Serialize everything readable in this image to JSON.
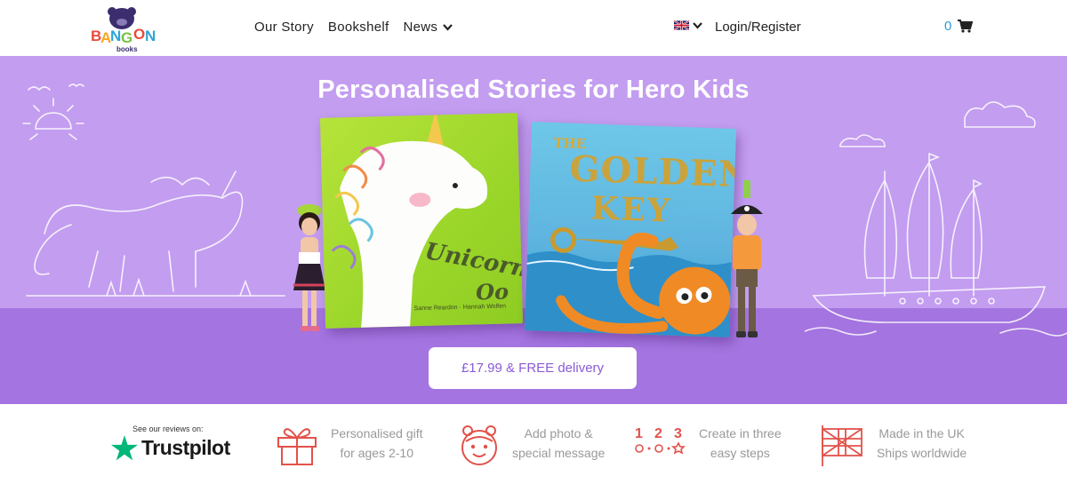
{
  "header": {
    "logo_text": "BANG ON books",
    "nav": [
      "Our Story",
      "Bookshelf",
      "News"
    ],
    "login": "Login/Register",
    "cart_count": "0",
    "flag_icon": "uk-flag-icon"
  },
  "hero": {
    "title": "Personalised Stories for Hero Kids",
    "book1": {
      "title_line1": "Unicorn",
      "title_line2": "Oo",
      "authors": "Sanne Reardon · Hannah Wolfen"
    },
    "book2": {
      "title_line1": "THE",
      "title_line2": "GOLDEN",
      "title_line3": "KEY"
    },
    "price_button": "£17.99 & FREE delivery"
  },
  "features": {
    "trustpilot_caption": "See our reviews on:",
    "trustpilot_name": "Trustpilot",
    "items": [
      {
        "line1": "Personalised gift",
        "line2": "for ages 2-10",
        "icon": "gift-icon"
      },
      {
        "line1": "Add photo &",
        "line2": "special message",
        "icon": "child-face-icon"
      },
      {
        "line1": "Create in three",
        "line2": "easy steps",
        "icon": "steps-123-icon"
      },
      {
        "line1": "Made in the UK",
        "line2": "Ships worldwide",
        "icon": "uk-flag-outline-icon"
      }
    ]
  },
  "colors": {
    "hero_bg": "#c39df0",
    "hero_floor": "#a474e0",
    "accent": "#8a5bd6",
    "feature_icon": "#e2524b",
    "cart_count": "#2f9bd6",
    "trustpilot_green": "#00b67a"
  }
}
